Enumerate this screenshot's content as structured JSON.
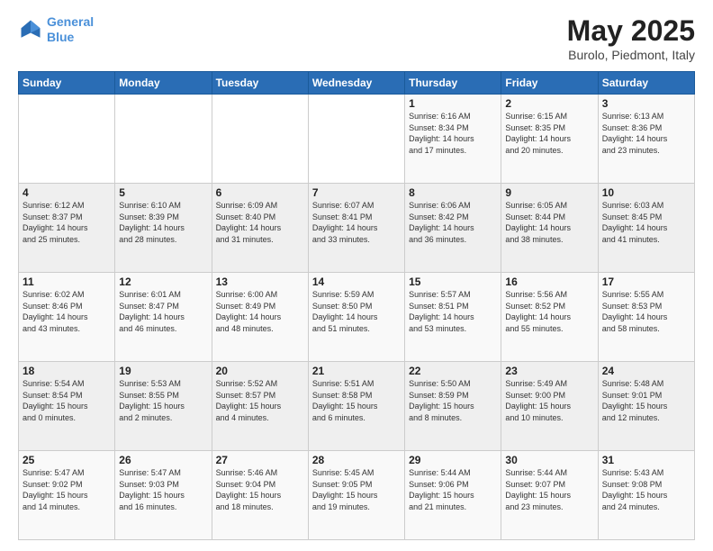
{
  "header": {
    "logo_line1": "General",
    "logo_line2": "Blue",
    "title": "May 2025",
    "subtitle": "Burolo, Piedmont, Italy"
  },
  "weekdays": [
    "Sunday",
    "Monday",
    "Tuesday",
    "Wednesday",
    "Thursday",
    "Friday",
    "Saturday"
  ],
  "weeks": [
    [
      {
        "day": "",
        "info": ""
      },
      {
        "day": "",
        "info": ""
      },
      {
        "day": "",
        "info": ""
      },
      {
        "day": "",
        "info": ""
      },
      {
        "day": "1",
        "info": "Sunrise: 6:16 AM\nSunset: 8:34 PM\nDaylight: 14 hours\nand 17 minutes."
      },
      {
        "day": "2",
        "info": "Sunrise: 6:15 AM\nSunset: 8:35 PM\nDaylight: 14 hours\nand 20 minutes."
      },
      {
        "day": "3",
        "info": "Sunrise: 6:13 AM\nSunset: 8:36 PM\nDaylight: 14 hours\nand 23 minutes."
      }
    ],
    [
      {
        "day": "4",
        "info": "Sunrise: 6:12 AM\nSunset: 8:37 PM\nDaylight: 14 hours\nand 25 minutes."
      },
      {
        "day": "5",
        "info": "Sunrise: 6:10 AM\nSunset: 8:39 PM\nDaylight: 14 hours\nand 28 minutes."
      },
      {
        "day": "6",
        "info": "Sunrise: 6:09 AM\nSunset: 8:40 PM\nDaylight: 14 hours\nand 31 minutes."
      },
      {
        "day": "7",
        "info": "Sunrise: 6:07 AM\nSunset: 8:41 PM\nDaylight: 14 hours\nand 33 minutes."
      },
      {
        "day": "8",
        "info": "Sunrise: 6:06 AM\nSunset: 8:42 PM\nDaylight: 14 hours\nand 36 minutes."
      },
      {
        "day": "9",
        "info": "Sunrise: 6:05 AM\nSunset: 8:44 PM\nDaylight: 14 hours\nand 38 minutes."
      },
      {
        "day": "10",
        "info": "Sunrise: 6:03 AM\nSunset: 8:45 PM\nDaylight: 14 hours\nand 41 minutes."
      }
    ],
    [
      {
        "day": "11",
        "info": "Sunrise: 6:02 AM\nSunset: 8:46 PM\nDaylight: 14 hours\nand 43 minutes."
      },
      {
        "day": "12",
        "info": "Sunrise: 6:01 AM\nSunset: 8:47 PM\nDaylight: 14 hours\nand 46 minutes."
      },
      {
        "day": "13",
        "info": "Sunrise: 6:00 AM\nSunset: 8:49 PM\nDaylight: 14 hours\nand 48 minutes."
      },
      {
        "day": "14",
        "info": "Sunrise: 5:59 AM\nSunset: 8:50 PM\nDaylight: 14 hours\nand 51 minutes."
      },
      {
        "day": "15",
        "info": "Sunrise: 5:57 AM\nSunset: 8:51 PM\nDaylight: 14 hours\nand 53 minutes."
      },
      {
        "day": "16",
        "info": "Sunrise: 5:56 AM\nSunset: 8:52 PM\nDaylight: 14 hours\nand 55 minutes."
      },
      {
        "day": "17",
        "info": "Sunrise: 5:55 AM\nSunset: 8:53 PM\nDaylight: 14 hours\nand 58 minutes."
      }
    ],
    [
      {
        "day": "18",
        "info": "Sunrise: 5:54 AM\nSunset: 8:54 PM\nDaylight: 15 hours\nand 0 minutes."
      },
      {
        "day": "19",
        "info": "Sunrise: 5:53 AM\nSunset: 8:55 PM\nDaylight: 15 hours\nand 2 minutes."
      },
      {
        "day": "20",
        "info": "Sunrise: 5:52 AM\nSunset: 8:57 PM\nDaylight: 15 hours\nand 4 minutes."
      },
      {
        "day": "21",
        "info": "Sunrise: 5:51 AM\nSunset: 8:58 PM\nDaylight: 15 hours\nand 6 minutes."
      },
      {
        "day": "22",
        "info": "Sunrise: 5:50 AM\nSunset: 8:59 PM\nDaylight: 15 hours\nand 8 minutes."
      },
      {
        "day": "23",
        "info": "Sunrise: 5:49 AM\nSunset: 9:00 PM\nDaylight: 15 hours\nand 10 minutes."
      },
      {
        "day": "24",
        "info": "Sunrise: 5:48 AM\nSunset: 9:01 PM\nDaylight: 15 hours\nand 12 minutes."
      }
    ],
    [
      {
        "day": "25",
        "info": "Sunrise: 5:47 AM\nSunset: 9:02 PM\nDaylight: 15 hours\nand 14 minutes."
      },
      {
        "day": "26",
        "info": "Sunrise: 5:47 AM\nSunset: 9:03 PM\nDaylight: 15 hours\nand 16 minutes."
      },
      {
        "day": "27",
        "info": "Sunrise: 5:46 AM\nSunset: 9:04 PM\nDaylight: 15 hours\nand 18 minutes."
      },
      {
        "day": "28",
        "info": "Sunrise: 5:45 AM\nSunset: 9:05 PM\nDaylight: 15 hours\nand 19 minutes."
      },
      {
        "day": "29",
        "info": "Sunrise: 5:44 AM\nSunset: 9:06 PM\nDaylight: 15 hours\nand 21 minutes."
      },
      {
        "day": "30",
        "info": "Sunrise: 5:44 AM\nSunset: 9:07 PM\nDaylight: 15 hours\nand 23 minutes."
      },
      {
        "day": "31",
        "info": "Sunrise: 5:43 AM\nSunset: 9:08 PM\nDaylight: 15 hours\nand 24 minutes."
      }
    ]
  ]
}
